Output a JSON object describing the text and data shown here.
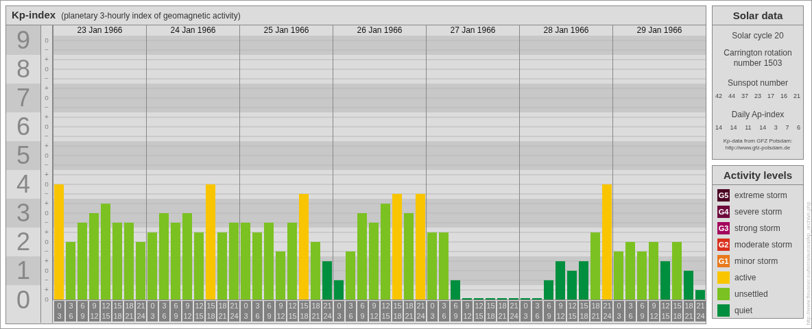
{
  "header": {
    "title": "Kp-index",
    "subtitle": "(planetary 3-hourly index of geomagnetic activity)"
  },
  "chart": {
    "days": [
      "23 Jan 1966",
      "24 Jan 1966",
      "25 Jan 1966",
      "26 Jan 1966",
      "27 Jan 1966",
      "28 Jan 1966",
      "29 Jan 1966"
    ],
    "y_marks": [
      "o",
      "−",
      "+",
      "o",
      "−",
      "+",
      "o",
      "−",
      "+",
      "o",
      "−",
      "+",
      "o",
      "−",
      "+",
      "o",
      "−",
      "+",
      "o",
      "−",
      "+",
      "o",
      "−",
      "+",
      "o",
      "−",
      "+",
      "o"
    ],
    "chart_data": {
      "type": "bar",
      "ylim": [
        0,
        9
      ],
      "grid": true,
      "bands": [
        {
          "axis": "y",
          "from": 0.5,
          "to": 1.5
        },
        {
          "axis": "y",
          "from": 2.5,
          "to": 3.5
        },
        {
          "axis": "y",
          "from": 4.5,
          "to": 5.5
        },
        {
          "axis": "y",
          "from": 6.5,
          "to": 7.5
        },
        {
          "axis": "y",
          "from": 8.5,
          "to": 9.5
        }
      ],
      "yticks": [
        {
          "value": 9,
          "label": "9"
        },
        {
          "value": 8,
          "label": "8"
        },
        {
          "value": 7,
          "label": "7"
        },
        {
          "value": 6,
          "label": "6"
        },
        {
          "value": 5,
          "label": "5"
        },
        {
          "value": 4,
          "label": "4"
        },
        {
          "value": 3,
          "label": "3"
        },
        {
          "value": 2,
          "label": "2"
        },
        {
          "value": 1,
          "label": "1"
        },
        {
          "value": 0,
          "label": "0"
        }
      ],
      "categories": [
        "0 3",
        "3 6",
        "6 9",
        "9 12",
        "12 15",
        "15 18",
        "18 21",
        "21 24",
        "0 3",
        "3 6",
        "6 9",
        "9 12",
        "12 15",
        "15 18",
        "18 21",
        "21 24",
        "0 3",
        "3 6",
        "6 9",
        "9 12",
        "12 15",
        "15 18",
        "18 21",
        "21 24",
        "0 3",
        "3 6",
        "6 9",
        "9 12",
        "12 15",
        "15 18",
        "18 21",
        "21 24",
        "0 3",
        "3 6",
        "6 9",
        "9 12",
        "12 15",
        "15 18",
        "18 21",
        "21 24",
        "0 3",
        "3 6",
        "6 9",
        "9 12",
        "12 15",
        "15 18",
        "18 21",
        "21 24",
        "0 3",
        "3 6",
        "6 9",
        "9 12",
        "12 15",
        "15 18",
        "18 21",
        "21 24"
      ],
      "values": [
        4,
        2,
        2.67,
        3,
        3.33,
        2.67,
        2.67,
        2,
        2.33,
        3,
        2.67,
        3,
        2.33,
        4,
        2.33,
        2.67,
        2.67,
        2.33,
        2.67,
        1.67,
        2.67,
        3.67,
        2,
        1.33,
        0.67,
        1.67,
        3,
        2.67,
        3.33,
        3.67,
        3,
        3.67,
        2.33,
        2.33,
        0.67,
        0,
        0,
        0,
        0,
        0,
        0,
        0,
        0.67,
        1.33,
        1,
        1.33,
        2.33,
        4,
        1.67,
        2,
        1.67,
        2,
        1.33,
        2,
        1,
        0.33
      ]
    }
  },
  "solar_data": {
    "title": "Solar data",
    "solar_cycle": "Solar cycle 20",
    "carrington": "Carrington rotation number 1503",
    "sunspot_label": "Sunspot number",
    "sunspot_values": [
      "42",
      "44",
      "37",
      "23",
      "17",
      "16",
      "21"
    ],
    "ap_label": "Daily Ap-index",
    "ap_values": [
      "14",
      "14",
      "11",
      "14",
      "3",
      "7",
      "6"
    ],
    "source_lines": [
      "Kp-data from GFZ Potsdam:",
      "http://www.gfz-potsdam.de"
    ]
  },
  "activity_levels": {
    "title": "Activity levels",
    "items": [
      {
        "badge": "G5",
        "label": "extreme storm",
        "color": "#4a0122"
      },
      {
        "badge": "G4",
        "label": "severe storm",
        "color": "#6e0a3c"
      },
      {
        "badge": "G3",
        "label": "strong storm",
        "color": "#a4045c"
      },
      {
        "badge": "G2",
        "label": "moderate storm",
        "color": "#d9301c"
      },
      {
        "badge": "G1",
        "label": "minor storm",
        "color": "#e8791c"
      },
      {
        "label": "active",
        "color": "#f8c500"
      },
      {
        "label": "unsettled",
        "color": "#7bc121"
      },
      {
        "label": "quiet",
        "color": "#008f3e"
      }
    ]
  },
  "credit": "http://www.fleusner.eu/terra/auroral/kp_archive.php"
}
